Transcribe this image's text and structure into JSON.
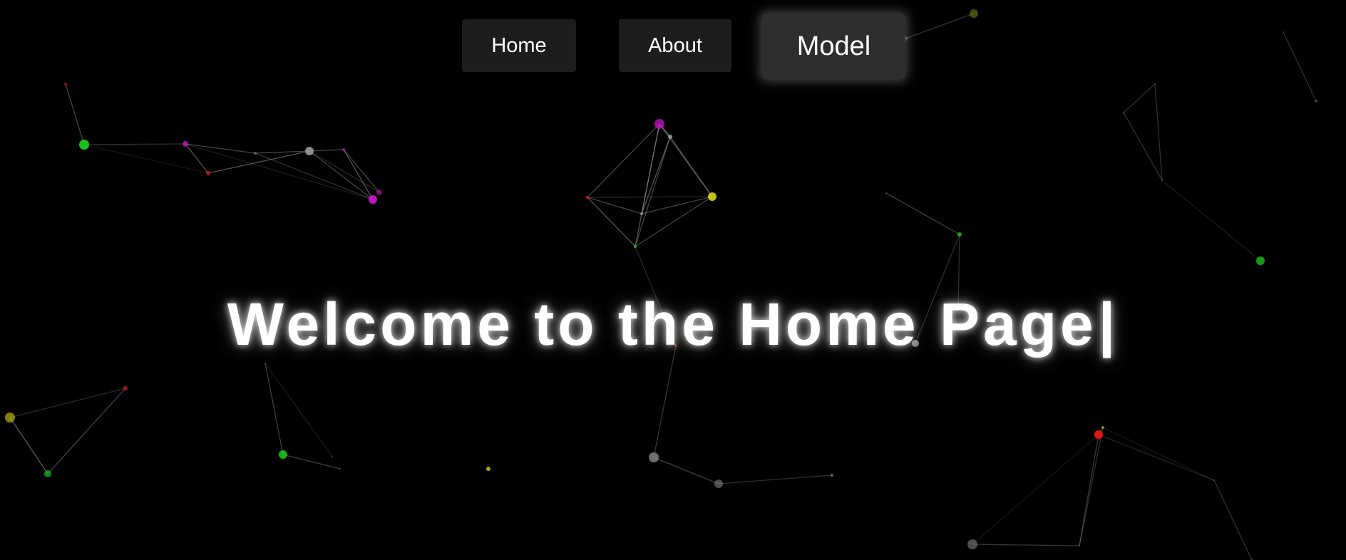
{
  "nav": {
    "home_label": "Home",
    "about_label": "About",
    "model_label": "Model",
    "active": "model"
  },
  "hero": {
    "title": "Welcome to the Home Page",
    "caret": "|"
  },
  "colors": {
    "background": "#000000",
    "button_bg": "#1d1d1d",
    "button_active_bg": "#2e2e2e",
    "text": "#ffffff",
    "link_line": "#8a8a8a",
    "node_green": "#17c21a",
    "node_magenta": "#d21ad2",
    "node_yellow": "#d6d21a",
    "node_red": "#e01515",
    "node_gray": "#9a9a9a"
  }
}
